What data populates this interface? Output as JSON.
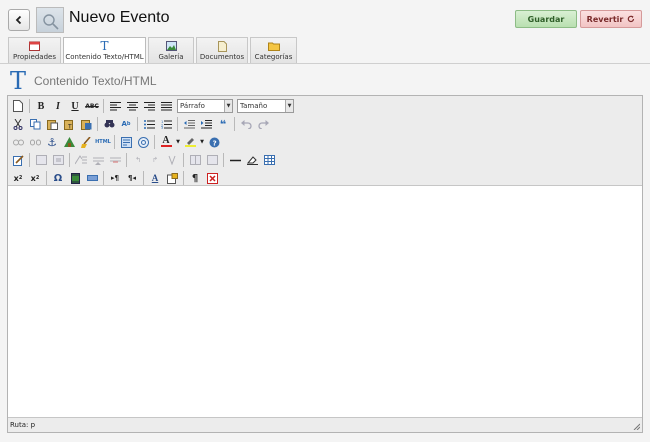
{
  "header": {
    "title": "Nuevo Evento",
    "save_label": "Guardar",
    "revert_label": "Revertir",
    "revert_icon": "refresh-icon",
    "back_icon": "chevron-left-icon"
  },
  "tabs": [
    {
      "label": "Propiedades",
      "icon": "calendar-icon"
    },
    {
      "label": "Contenido Texto/HTML",
      "icon": "text-t-icon"
    },
    {
      "label": "Galería",
      "icon": "image-icon"
    },
    {
      "label": "Documentos",
      "icon": "document-icon"
    },
    {
      "label": "Categorías",
      "icon": "folder-icon"
    }
  ],
  "section": {
    "icon_glyph": "T",
    "title": "Contenido Texto/HTML"
  },
  "editor": {
    "format_select": "Párrafo",
    "size_select": "Tamaño",
    "bold": "B",
    "italic": "I",
    "underline": "U",
    "strike": "ABC",
    "html": "HTML",
    "status_path": "Ruta: p"
  },
  "colors": {
    "accent": "#2a6bb4",
    "save_bg": "#c8e8c0",
    "revert_bg": "#f6d2d2"
  }
}
